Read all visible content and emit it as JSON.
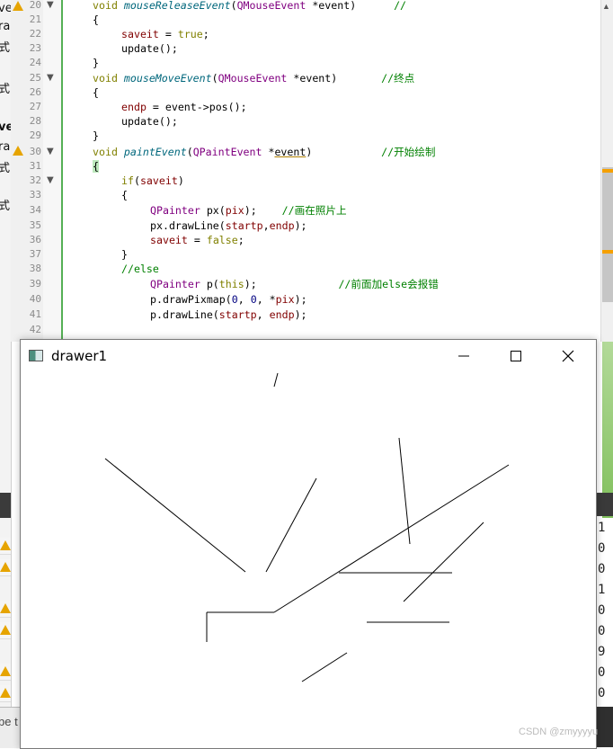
{
  "left_sliver": {
    "fragments": [
      "ve",
      "ra",
      "式",
      "",
      "",
      "式",
      "",
      "ve",
      "ra",
      "式",
      "",
      "式"
    ],
    "bottom_text": "be t"
  },
  "editor": {
    "lines": [
      {
        "num": "20",
        "fold": "▼",
        "warn": true
      },
      {
        "num": "21"
      },
      {
        "num": "22"
      },
      {
        "num": "23"
      },
      {
        "num": "24"
      },
      {
        "num": "25",
        "fold": "▼"
      },
      {
        "num": "26"
      },
      {
        "num": "27"
      },
      {
        "num": "28"
      },
      {
        "num": "29"
      },
      {
        "num": "30",
        "fold": "▼",
        "warn": true
      },
      {
        "num": "31"
      },
      {
        "num": "32",
        "fold": "▼"
      },
      {
        "num": "33"
      },
      {
        "num": "34"
      },
      {
        "num": "35"
      },
      {
        "num": "36"
      },
      {
        "num": "37"
      },
      {
        "num": "38"
      },
      {
        "num": "39"
      },
      {
        "num": "40"
      },
      {
        "num": "41"
      },
      {
        "num": "42"
      }
    ],
    "code": {
      "l20": {
        "void": "void",
        "fn": "mouseReleaseEvent",
        "p": "(",
        "ty": "QMouseEvent",
        "rest": " *event)",
        "cm": "//"
      },
      "l21": "{",
      "l22": {
        "var": "saveit",
        "op": " = ",
        "val": "true",
        "end": ";"
      },
      "l23": "update();",
      "l24": "}",
      "l25": {
        "void": "void",
        "fn": "mouseMoveEvent",
        "p": "(",
        "ty": "QMouseEvent",
        "rest": " *event)",
        "cm": "//终点"
      },
      "l26": "{",
      "l27": {
        "var": "endp",
        "rest": " = event->pos();"
      },
      "l28": "update();",
      "l29": "}",
      "l30": {
        "void": "void",
        "fn": "paintEvent",
        "p": "(",
        "ty": "QPaintEvent",
        "rest1": " *",
        "ev": "event",
        "rest2": ")",
        "cm": "//开始绘制"
      },
      "l31": "{",
      "l32": {
        "kw": "if",
        "p": "(",
        "var": "saveit",
        "end": ")"
      },
      "l33": "{",
      "l34": {
        "ty": "QPainter",
        "rest": " px(",
        "var": "pix",
        "end": ");",
        "cm": "//画在照片上"
      },
      "l35": {
        "pre": "px.drawLine(",
        "a": "startp",
        "c": ",",
        "b": "endp",
        "end": ");"
      },
      "l36": {
        "var": "saveit",
        "op": " = ",
        "val": "false",
        "end": ";"
      },
      "l37": "}",
      "l38": "//else",
      "l39": {
        "ty": "QPainter",
        "rest": " p(",
        "kw": "this",
        "end": ");",
        "cm": "//前面加else会报错"
      },
      "l40": {
        "pre": "p.drawPixmap(",
        "n1": "0",
        "c1": ", ",
        "n2": "0",
        "c2": ", *",
        "var": "pix",
        "end": ");"
      },
      "l41": {
        "pre": "p.drawLine(",
        "a": "startp",
        "c": ", ",
        "b": "endp",
        "end": ");"
      },
      "l42": ""
    }
  },
  "right_column": {
    "digits": [
      "1",
      "0",
      "0",
      "1",
      "0",
      "0",
      "9",
      "0",
      "0"
    ]
  },
  "window": {
    "title": "drawer1",
    "minimize_glyph": "—",
    "maximize_glyph": "☐",
    "close_glyph": "✕"
  },
  "drawing_segments": [
    [
      305,
      430,
      309,
      415
    ],
    [
      117,
      510,
      273,
      636
    ],
    [
      296,
      636,
      352,
      532
    ],
    [
      444,
      487,
      456,
      605
    ],
    [
      566,
      517,
      305,
      681
    ],
    [
      305,
      681,
      230,
      681
    ],
    [
      230,
      681,
      230,
      714
    ],
    [
      377,
      637,
      503,
      637
    ],
    [
      538,
      581,
      449,
      669
    ],
    [
      408,
      692,
      500,
      692
    ],
    [
      386,
      726,
      336,
      758
    ]
  ],
  "watermark": "CSDN @zmyyyyu",
  "colors": {
    "keyword": "#808000",
    "function": "#00677c",
    "type": "#800080",
    "variable": "#800000",
    "comment": "#008000",
    "literal": "#000080",
    "warning": "#e6a400",
    "fold_border": "#55b055"
  }
}
